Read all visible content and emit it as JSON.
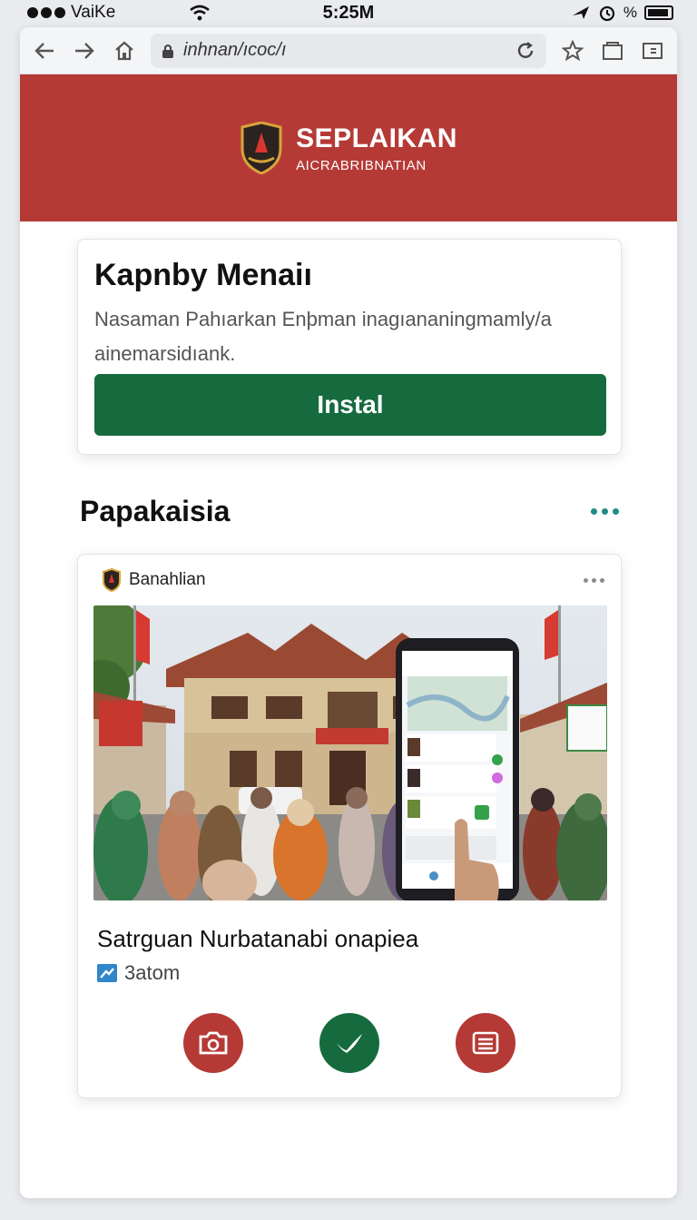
{
  "status": {
    "carrier": "VaiKe",
    "time": "5:25M",
    "battery_text": "%"
  },
  "browser": {
    "url": "inhnan/ıcoc/ı"
  },
  "header": {
    "title": "SEPLAIKAN",
    "subtitle": "AICRABRIBNATIAN"
  },
  "install_card": {
    "title": "Kapnby Menaiı",
    "description": "Nasaman Pahıarkan Enþman inagıananingmamly/a ainemarsidıank.",
    "button_label": "Instal"
  },
  "section": {
    "title": "Papakaisia"
  },
  "feed": {
    "source": "Banahlian",
    "title": "Satrguan Nurbatanabi onapiea",
    "meta": "3atom"
  },
  "colors": {
    "header_red": "#b53a36",
    "install_green": "#166b3e",
    "dots_teal": "#1f8b86"
  },
  "icons": {
    "action_left": "camera-icon",
    "action_middle": "check-icon",
    "action_right": "document-icon"
  }
}
